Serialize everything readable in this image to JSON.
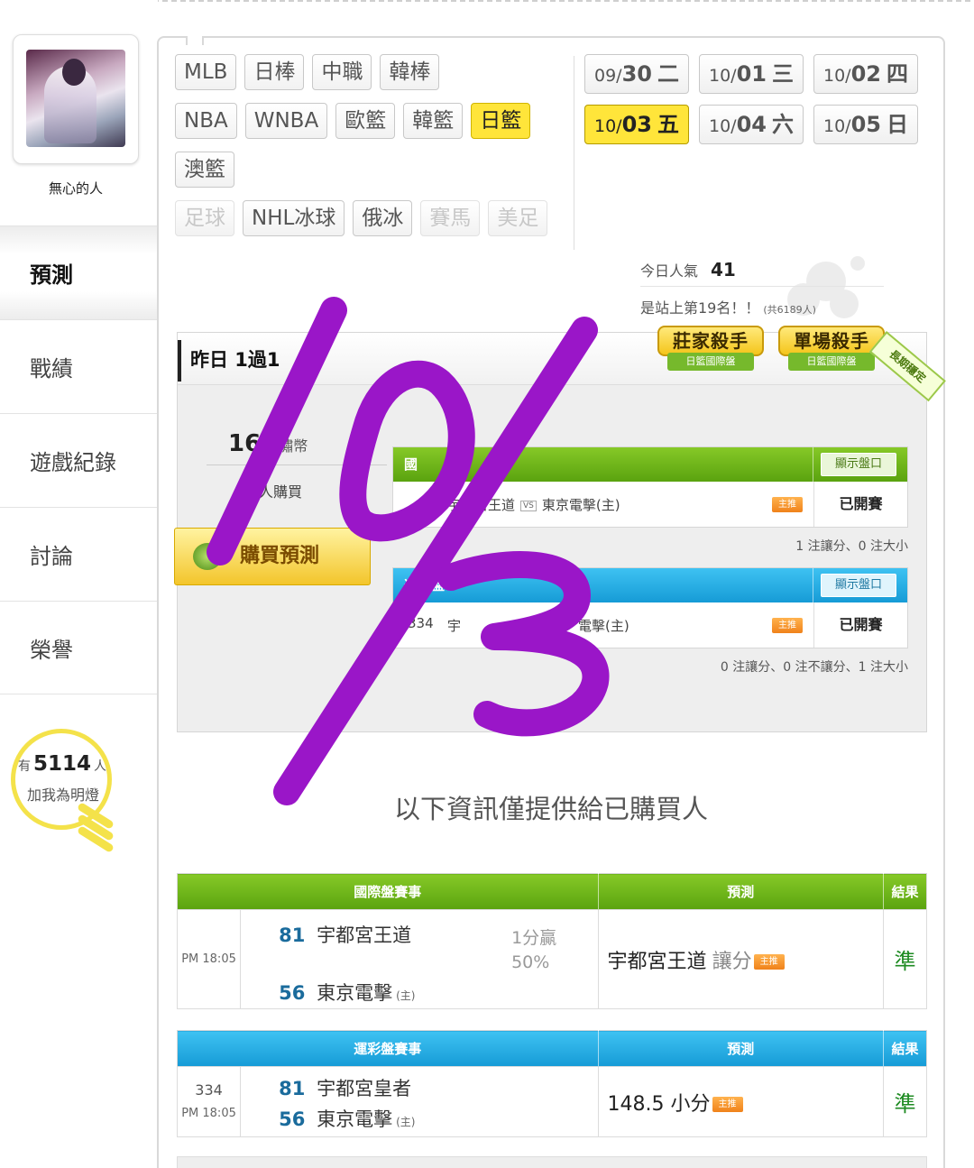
{
  "user": {
    "name": "無心的人"
  },
  "nav": [
    {
      "label": "預測",
      "active": true
    },
    {
      "label": "戰績",
      "active": false
    },
    {
      "label": "遊戲紀錄",
      "active": false
    },
    {
      "label": "討論",
      "active": false
    },
    {
      "label": "榮譽",
      "active": false
    }
  ],
  "fans": {
    "prefix": "有",
    "count": "5114",
    "suffix": "人",
    "text": "加我為明燈"
  },
  "sports": {
    "row1": [
      {
        "label": "MLB"
      },
      {
        "label": "日棒"
      },
      {
        "label": "中職"
      },
      {
        "label": "韓棒"
      }
    ],
    "row2": [
      {
        "label": "NBA"
      },
      {
        "label": "WNBA"
      },
      {
        "label": "歐籃"
      },
      {
        "label": "韓籃"
      },
      {
        "label": "日籃",
        "active": true
      }
    ],
    "row3": [
      {
        "label": "澳籃"
      }
    ],
    "row4": [
      {
        "label": "足球",
        "disabled": true
      },
      {
        "label": "NHL冰球"
      },
      {
        "label": "俄冰"
      },
      {
        "label": "賽馬",
        "disabled": true
      },
      {
        "label": "美足",
        "disabled": true
      }
    ]
  },
  "dates": [
    {
      "prefix": "09/",
      "day": "30",
      "weekday": "二"
    },
    {
      "prefix": "10/",
      "day": "01",
      "weekday": "三"
    },
    {
      "prefix": "10/",
      "day": "02",
      "weekday": "四"
    },
    {
      "prefix": "10/",
      "day": "03",
      "weekday": "五",
      "active": true
    },
    {
      "prefix": "10/",
      "day": "04",
      "weekday": "六"
    },
    {
      "prefix": "10/",
      "day": "05",
      "weekday": "日"
    }
  ],
  "popularity": {
    "label": "今日人氣",
    "value": "41",
    "rank": "是站上第19名！！",
    "total": "(共6189人)"
  },
  "prediction": {
    "title": "昨日 1過1",
    "badge1_top": "莊家殺手",
    "badge1_bottom": "日籃國際盤",
    "badge2_top": "單場殺手",
    "badge2_bottom": "日籃國際盤",
    "ribbon": "長期穩定",
    "price": "16",
    "price_unit": "元嘯幣",
    "buyers": "人購買",
    "buy_button": "購買預測",
    "intl": {
      "title": "國",
      "show": "顯示盤口",
      "teams_home": "宇都宮王道",
      "vs": "VS",
      "teams_away": "東京電擊(主)",
      "tag": "主推",
      "status": "已開賽",
      "note": "1 注讓分、0 注大小"
    },
    "lottery": {
      "title": "運彩盤",
      "show": "顯示盤口",
      "num": "334",
      "teams": "宇",
      "teams_away": "電擊(主)",
      "tag": "主推",
      "status": "已開賽",
      "note": "0 注讓分、0 注不讓分、1 注大小"
    }
  },
  "notice": "以下資訊僅提供給已購買人",
  "results": {
    "intl": {
      "headers": [
        "國際盤賽事",
        "預測",
        "結果"
      ],
      "time": "PM 18:05",
      "away_score": "81",
      "away_team": "宇都宮王道",
      "home_score": "56",
      "home_team": "東京電擊",
      "home_mark": "(主)",
      "handicap_line1": "1分贏",
      "handicap_line2": "50%",
      "pick": "宇都宮王道",
      "pick_type": "讓分",
      "tag": "主推",
      "result": "準"
    },
    "lottery": {
      "headers": [
        "運彩盤賽事",
        "預測",
        "結果"
      ],
      "game_no": "334",
      "time": "PM 18:05",
      "away_score": "81",
      "away_team": "宇都宮皇者",
      "home_score": "56",
      "home_team": "東京電擊",
      "home_mark": "(主)",
      "pick": "148.5 小分",
      "tag": "主推",
      "result": "準"
    }
  },
  "colors": {
    "accent_yellow": "#ffe53a",
    "green_header": "#6cb31a",
    "blue_header": "#1fa8e0",
    "scribble": "#9a16c8"
  }
}
